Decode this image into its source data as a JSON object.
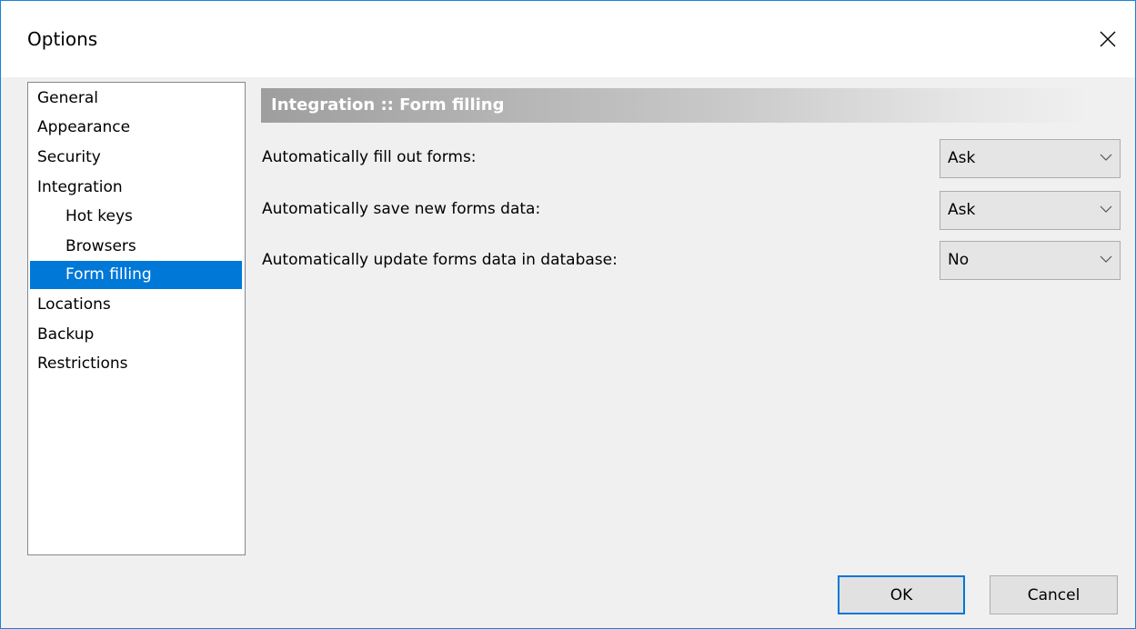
{
  "window": {
    "title": "Options"
  },
  "nav": {
    "items": [
      {
        "label": "General",
        "indent": 0,
        "selected": false
      },
      {
        "label": "Appearance",
        "indent": 0,
        "selected": false
      },
      {
        "label": "Security",
        "indent": 0,
        "selected": false
      },
      {
        "label": "Integration",
        "indent": 0,
        "selected": false
      },
      {
        "label": "Hot keys",
        "indent": 1,
        "selected": false
      },
      {
        "label": "Browsers",
        "indent": 1,
        "selected": false
      },
      {
        "label": "Form filling",
        "indent": 1,
        "selected": true
      },
      {
        "label": "Locations",
        "indent": 0,
        "selected": false
      },
      {
        "label": "Backup",
        "indent": 0,
        "selected": false
      },
      {
        "label": "Restrictions",
        "indent": 0,
        "selected": false
      }
    ]
  },
  "panel": {
    "header": "Integration :: Form filling",
    "rows": [
      {
        "label": "Automatically fill out forms:",
        "value": "Ask"
      },
      {
        "label": "Automatically save new forms data:",
        "value": "Ask"
      },
      {
        "label": "Automatically update forms data in database:",
        "value": "No"
      }
    ]
  },
  "buttons": {
    "ok": "OK",
    "cancel": "Cancel"
  },
  "colors": {
    "accent": "#0078d7",
    "window_border": "#1883d7"
  }
}
